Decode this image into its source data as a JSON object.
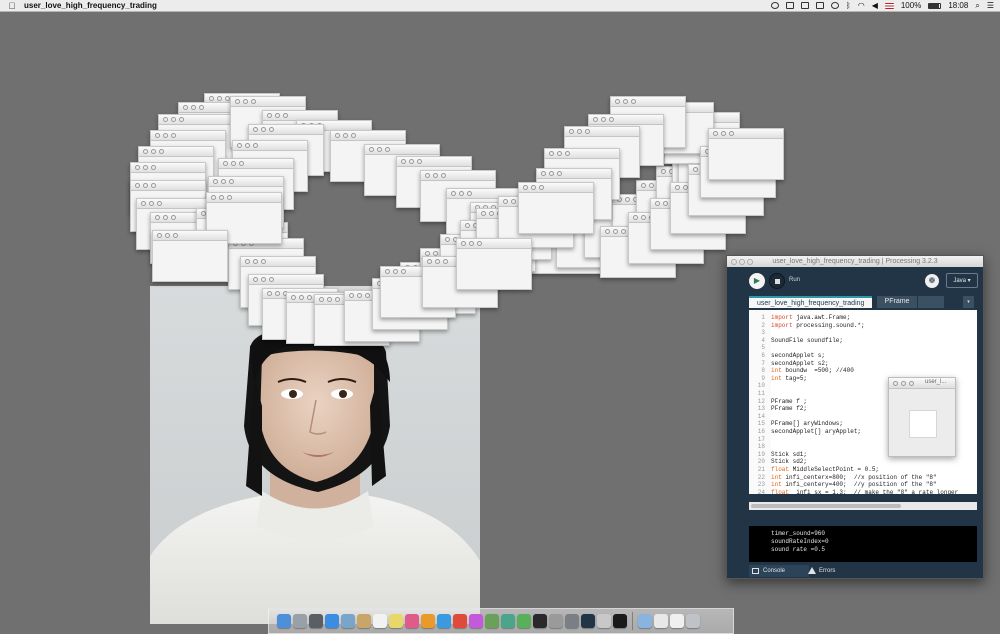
{
  "menubar": {
    "apple_icon": "apple-icon",
    "app_title": "user_love_high_frequency_trading",
    "battery": "100%",
    "time": "18:08",
    "icons": [
      "record-icon",
      "media-icon",
      "airplay-icon",
      "display-icon",
      "clock-icon",
      "bluetooth-icon",
      "wifi-icon",
      "volume-icon",
      "flag-icon",
      "battery-icon",
      "search-icon",
      "list-icon"
    ]
  },
  "processing": {
    "window_title": "user_love_high_frequency_trading | Processing 3.2.3",
    "run_label": "Run",
    "mode_label": "Java ▾",
    "tab_active": "user_love_high_frequency_trading",
    "tab_second": "PFrame",
    "tab_menu": "▾",
    "code_lines": [
      {
        "n": "1",
        "kw": "import",
        "rest": " java.awt.Frame;"
      },
      {
        "n": "2",
        "kw": "import",
        "rest": " processing.sound.*;"
      },
      {
        "n": "3",
        "kw": "",
        "rest": ""
      },
      {
        "n": "4",
        "kw": "",
        "rest": "SoundFile soundfile;"
      },
      {
        "n": "5",
        "kw": "",
        "rest": ""
      },
      {
        "n": "6",
        "kw": "",
        "rest": "secondApplet s;"
      },
      {
        "n": "7",
        "kw": "",
        "rest": "secondApplet s2;"
      },
      {
        "n": "8",
        "kw": "int",
        "rest": " boundw  =500; //400"
      },
      {
        "n": "9",
        "kw": "int",
        "rest": " tag=5;"
      },
      {
        "n": "10",
        "kw": "",
        "rest": ""
      },
      {
        "n": "11",
        "kw": "",
        "rest": ""
      },
      {
        "n": "12",
        "kw": "",
        "rest": "PFrame f ;"
      },
      {
        "n": "13",
        "kw": "",
        "rest": "PFrame f2;"
      },
      {
        "n": "14",
        "kw": "",
        "rest": ""
      },
      {
        "n": "15",
        "kw": "",
        "rest": "PFrame[] aryWindows;"
      },
      {
        "n": "16",
        "kw": "",
        "rest": "secondApplet[] aryApplet;"
      },
      {
        "n": "17",
        "kw": "",
        "rest": ""
      },
      {
        "n": "18",
        "kw": "",
        "rest": ""
      },
      {
        "n": "19",
        "kw": "",
        "rest": "Stick sd1;"
      },
      {
        "n": "20",
        "kw": "",
        "rest": "Stick sd2;"
      },
      {
        "n": "21",
        "kw": "float",
        "rest": " MiddleSelectPoint = 0.5;"
      },
      {
        "n": "22",
        "kw": "int",
        "rest": " infi_centerx=800;  //x position of the \"8\""
      },
      {
        "n": "23",
        "kw": "int",
        "rest": " infi_centery=400;  //y position of the \"8\""
      },
      {
        "n": "24",
        "kw": "float",
        "rest": "  infi_sx = 1.3;  // make the \"8\" a rate longer"
      }
    ],
    "console_lines": [
      "timer_sound=960",
      "soundRateIndex=0",
      "sound rate =0.5"
    ],
    "console_tab": "Console",
    "errors_tab": "Errors"
  },
  "sketch_window": {
    "title": "user_l..."
  },
  "dock": {
    "apps": [
      {
        "name": "finder-icon",
        "color": "#4d8fd9"
      },
      {
        "name": "launchpad-icon",
        "color": "#9aa0a8"
      },
      {
        "name": "mission-control-icon",
        "color": "#5a5f66"
      },
      {
        "name": "safari-icon",
        "color": "#3a8de0"
      },
      {
        "name": "photo-icon",
        "color": "#7aa5c8"
      },
      {
        "name": "preview-icon",
        "color": "#c9a56a"
      },
      {
        "name": "calendar-icon",
        "color": "#f2f2f2"
      },
      {
        "name": "notes-icon",
        "color": "#e8d86a"
      },
      {
        "name": "itunes-icon",
        "color": "#e05a8a"
      },
      {
        "name": "ibooks-icon",
        "color": "#e89a2a"
      },
      {
        "name": "app-store-icon",
        "color": "#3a9ae0"
      },
      {
        "name": "chrome-icon",
        "color": "#e04a3a"
      },
      {
        "name": "photos-icon",
        "color": "#c35ad9"
      },
      {
        "name": "camera-icon",
        "color": "#6aa05a"
      },
      {
        "name": "maps-icon",
        "color": "#4aa58a"
      },
      {
        "name": "messages-icon",
        "color": "#5ab05a"
      },
      {
        "name": "terminal-icon",
        "color": "#2a2a2a"
      },
      {
        "name": "activity-monitor-icon",
        "color": "#9a9a9a"
      },
      {
        "name": "system-preferences-icon",
        "color": "#7a7f86"
      },
      {
        "name": "processing-icon",
        "color": "#213546"
      },
      {
        "name": "pdf-icon",
        "color": "#c8c8c8"
      },
      {
        "name": "video-icon",
        "color": "#1a1a1a"
      }
    ],
    "others": [
      {
        "name": "folder-icon",
        "color": "#8ab4e0"
      },
      {
        "name": "downloads-icon",
        "color": "#e8e8e8"
      },
      {
        "name": "document-icon",
        "color": "#f0f0f0"
      },
      {
        "name": "trash-icon",
        "color": "#bfc3c8"
      }
    ]
  }
}
